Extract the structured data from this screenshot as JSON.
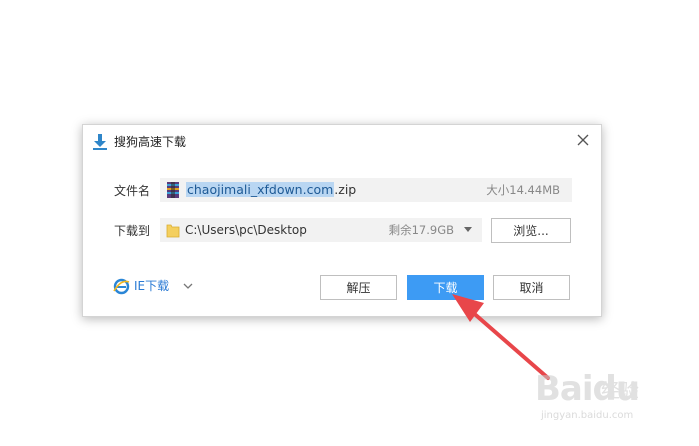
{
  "dialog": {
    "title": "搜狗高速下载",
    "title_icon": "download-arrow-icon",
    "close_icon": "close-icon",
    "filename_label": "文件名",
    "filename_selected": "chaojimali_xfdown.com",
    "filename_ext": ".zip",
    "filesize": "大小14.44MB",
    "file_icon": "winrar-archive-icon",
    "saveto_label": "下载到",
    "save_path": "C:\\Users\\pc\\Desktop",
    "free_space": "剩余17.9GB",
    "folder_icon": "folder-icon",
    "browse_button": "浏览...",
    "ie_download_label": "IE下载",
    "ie_icon": "ie-browser-icon",
    "extract_button": "解压",
    "download_button": "下载",
    "cancel_button": "取消"
  },
  "colors": {
    "primary": "#3d9bf4",
    "link": "#2a7ad4",
    "selection": "#b9d6f2",
    "annotation_arrow": "#e8464a"
  },
  "watermark": {
    "brand": "Baidu",
    "jingyan": "经验",
    "url": "jingyan.baidu.com"
  }
}
